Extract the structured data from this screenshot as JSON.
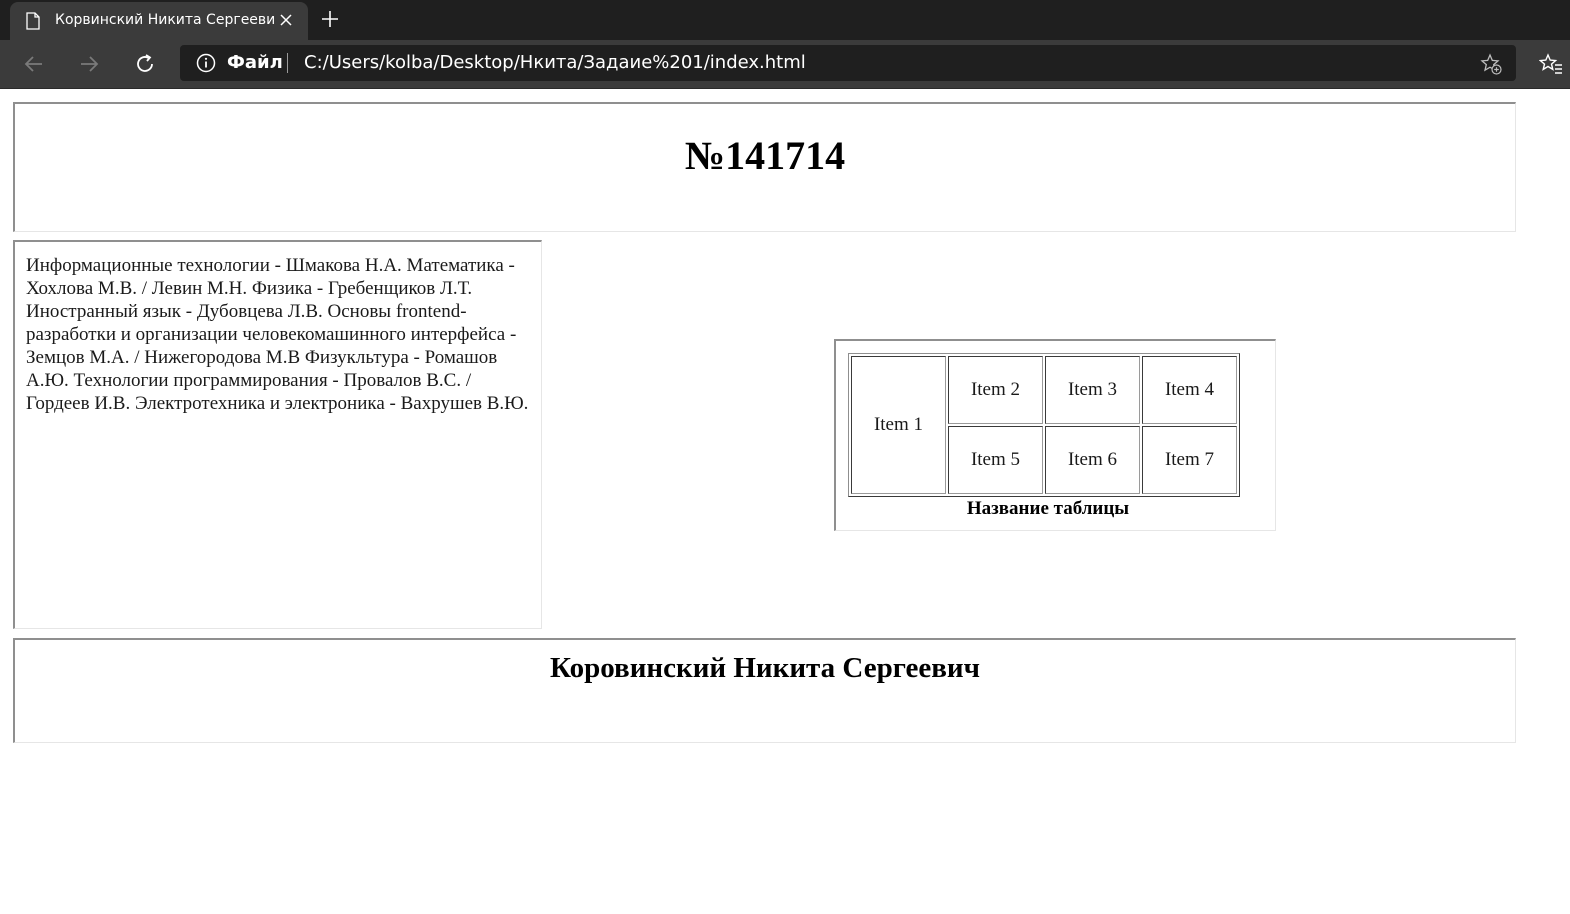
{
  "browser": {
    "tab_title": "Корвинский Никита Сергеевич",
    "site_label": "Файл",
    "url": "C:/Users/kolba/Desktop/Нкита/Задаие%201/index.html"
  },
  "page": {
    "title": "№141714",
    "subjects": "Информационные технологии - Шмакова Н.А. Математика - Хохлова М.В. / Левин М.Н. Физика - Гребенщиков Л.Т. Иностранный язык - Дубовцева Л.В. Основы frontend-разработки и организации человекомашинного интерфейса - Земцов М.А. / Нижегородова М.В Физукльтура - Ромашов А.Ю. Технологии программирования - Провалов В.С. / Гордеев И.В. Электротехника и электроника - Вахрушев В.Ю.",
    "table": {
      "cells": [
        "Item 1",
        "Item 2",
        "Item 3",
        "Item 4",
        "Item 5",
        "Item 6",
        "Item 7"
      ],
      "caption": "Название таблицы"
    },
    "footer_name": "Коровинский Никита Сергеевич"
  },
  "colors": {
    "tabstrip_bg": "#1f1f1f",
    "toolbar_bg": "#3b3b3b",
    "address_bg": "#1f1f1f",
    "page_bg": "#ffffff"
  }
}
